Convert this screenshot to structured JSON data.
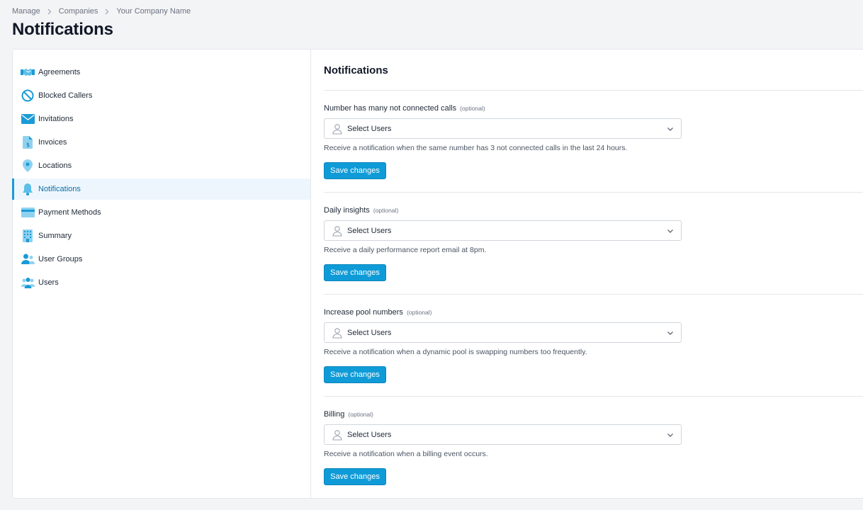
{
  "breadcrumb": [
    "Manage",
    "Companies",
    "Your Company Name"
  ],
  "page_title": "Notifications",
  "sidebar": {
    "items": [
      {
        "label": "Agreements",
        "icon": "handshake-icon"
      },
      {
        "label": "Blocked Callers",
        "icon": "block-icon"
      },
      {
        "label": "Invitations",
        "icon": "envelope-icon"
      },
      {
        "label": "Invoices",
        "icon": "invoice-icon"
      },
      {
        "label": "Locations",
        "icon": "map-pin-icon"
      },
      {
        "label": "Notifications",
        "icon": "bell-icon",
        "active": true
      },
      {
        "label": "Payment Methods",
        "icon": "credit-card-icon"
      },
      {
        "label": "Summary",
        "icon": "building-icon"
      },
      {
        "label": "User Groups",
        "icon": "user-group-icon"
      },
      {
        "label": "Users",
        "icon": "users-icon"
      }
    ]
  },
  "main": {
    "title": "Notifications",
    "sections": [
      {
        "label": "Number has many not connected calls",
        "optional": "(optional)",
        "select_value": "Select Users",
        "description": "Receive a notification when the same number has 3 not connected calls in the last 24 hours.",
        "button": "Save changes"
      },
      {
        "label": "Daily insights",
        "optional": "(optional)",
        "select_value": "Select Users",
        "description": "Receive a daily performance report email at 8pm.",
        "button": "Save changes"
      },
      {
        "label": "Increase pool numbers",
        "optional": "(optional)",
        "select_value": "Select Users",
        "description": "Receive a notification when a dynamic pool is swapping numbers too frequently.",
        "button": "Save changes"
      },
      {
        "label": "Billing",
        "optional": "(optional)",
        "select_value": "Select Users",
        "description": "Receive a notification when a billing event occurs.",
        "button": "Save changes"
      }
    ]
  },
  "colors": {
    "accent": "#0f9bd7",
    "icon": "#1a9bd7",
    "active_bg": "#eef6fd"
  }
}
